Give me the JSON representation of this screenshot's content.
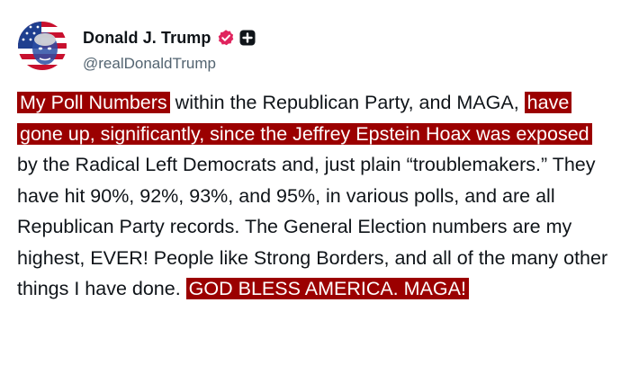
{
  "post": {
    "author": {
      "display_name": "Donald J. Trump",
      "handle": "@realDonaldTrump",
      "avatar_icon": "flag-portrait-avatar",
      "verified_icon": "verified-badge-icon",
      "verified_color": "#e0245e",
      "affiliation_icon": "plus-badge-icon"
    },
    "text": {
      "segment_1_highlight": "My Poll Numbers",
      "segment_2": " within the Republican Party, and MAGA, ",
      "segment_3_highlight": "have gone up, significantly, since the Jeffrey Epstein Hoax was exposed",
      "segment_4": " by the Radical Left Democrats and, just plain “troublemakers.” They have hit 90%, 92%, 93%, and 95%, in various polls, and are all Republican Party records. The General Election numbers are my highest, EVER! People like Strong Borders, and all of the many other things I have done. ",
      "segment_5_highlight": "GOD BLESS AMERICA. MAGA!"
    },
    "highlight_color": "#9b0000"
  }
}
